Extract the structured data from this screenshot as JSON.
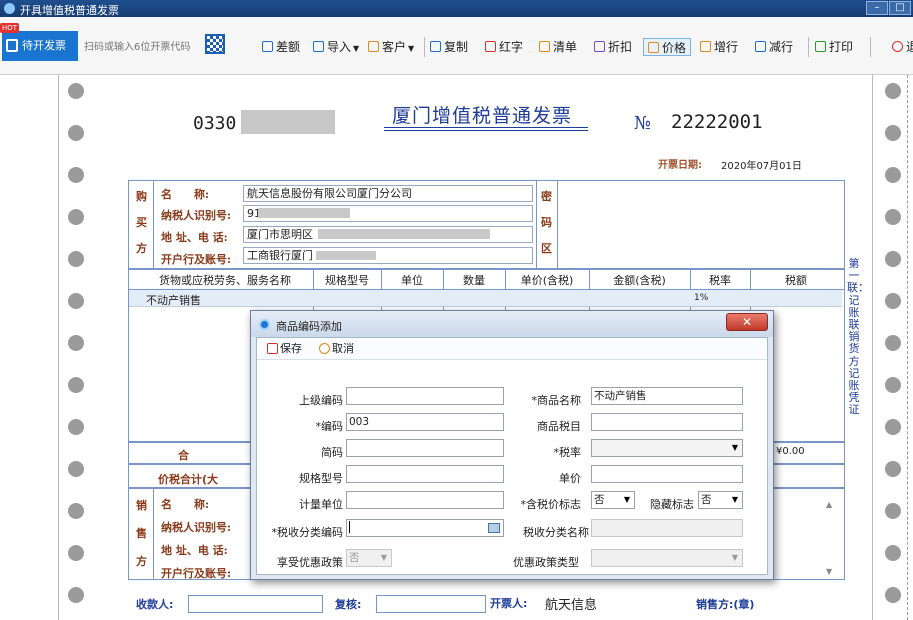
{
  "window": {
    "title": "开具增值税普通发票",
    "min": "–",
    "max": "□"
  },
  "toolbar": {
    "hot": "HOT",
    "pending": "待开发票",
    "scan_placeholder": "扫码或输入6位开票代码",
    "buttons": {
      "diff": "差额",
      "import": "导入",
      "customer": "客户",
      "copy": "复制",
      "red": "红字",
      "list": "清单",
      "discount": "折扣",
      "price": "价格",
      "add_row": "增行",
      "del_row": "减行",
      "print": "打印",
      "exit": "退"
    }
  },
  "invoice": {
    "code_prefix": "0330",
    "title": "厦门增值税普通发票",
    "no_label": "№",
    "number": "22222001",
    "date_label": "开票日期:",
    "date": "2020年07月01日",
    "buyer": {
      "vertical": [
        "购",
        "买",
        "方"
      ],
      "name_label": "名　　称:",
      "name": "航天信息股份有限公司厦门分公司",
      "taxid_label": "纳税人识别号:",
      "taxid": "91",
      "addr_label": "地 址、电 话:",
      "addr": "厦门市思明区",
      "bank_label": "开户行及账号:",
      "bank": "工商银行厦门"
    },
    "cipher": [
      "密",
      "码",
      "区"
    ],
    "columns": [
      "货物或应税劳务、服务名称",
      "规格型号",
      "单位",
      "数量",
      "单价(含税)",
      "金额(含税)",
      "税率",
      "税额"
    ],
    "rows": [
      {
        "name": "不动产销售",
        "rate": "1%"
      }
    ],
    "sum_label": "合",
    "sum_tax": "¥0.00",
    "total_label": "价税合计(大",
    "seller": {
      "vertical": [
        "销",
        "售",
        "方"
      ],
      "name_label": "名　　称:",
      "taxid_label": "纳税人识别号:",
      "addr_label": "地 址、电 话:",
      "bank_label": "开户行及账号:"
    },
    "side_text": "第一联：记账联 销货方记账凭证",
    "footer": {
      "payee_label": "收款人:",
      "reviewer_label": "复核:",
      "issuer_label": "开票人:",
      "issuer": "航天信息",
      "seller_seal": "销售方:(章)"
    }
  },
  "dialog": {
    "title": "商品编码添加",
    "close": "✕",
    "save": "保存",
    "cancel": "取消",
    "fields": {
      "parent_code_label": "上级编码",
      "parent_code": "",
      "code_label": "*编码",
      "code": "003",
      "short_code_label": "简码",
      "short_code": "",
      "spec_label": "规格型号",
      "spec": "",
      "unit_label": "计量单位",
      "unit": "",
      "tax_class_code_label": "*税收分类编码",
      "tax_class_code": "",
      "preferential_label": "享受优惠政策",
      "preferential": "否",
      "item_name_label": "*商品名称",
      "item_name": "不动产销售",
      "tax_item_label": "商品税目",
      "tax_item": "",
      "tax_rate_label": "*税率",
      "tax_rate": "",
      "unit_price_label": "单价",
      "unit_price": "",
      "incl_tax_label": "*含税价标志",
      "incl_tax": "否",
      "hidden_label": "隐藏标志",
      "hidden": "否",
      "tax_class_name_label": "税收分类名称",
      "tax_class_name": "",
      "pref_type_label": "优惠政策类型",
      "pref_type": ""
    }
  }
}
